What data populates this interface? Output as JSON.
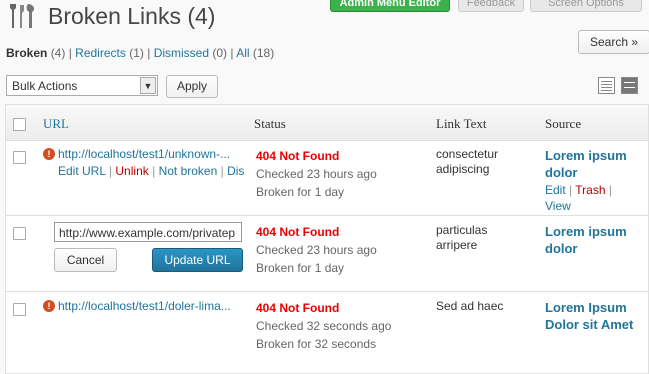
{
  "header": {
    "title": "Broken Links (4)",
    "top_buttons": [
      "Admin Menu Editor",
      "Feedback",
      "Screen Options"
    ]
  },
  "filters": [
    {
      "label": "Broken",
      "count": "(4)",
      "current": true
    },
    {
      "label": "Redirects",
      "count": "(1)"
    },
    {
      "label": "Dismissed",
      "count": "(0)"
    },
    {
      "label": "All",
      "count": "(18)"
    }
  ],
  "search_button": "Search »",
  "bulk_actions": {
    "selected": "Bulk Actions",
    "apply_label": "Apply"
  },
  "table": {
    "columns": [
      "URL",
      "Status",
      "Link Text",
      "Source"
    ],
    "rows": [
      {
        "url": "http://localhost/test1/unknown-...",
        "actions": [
          "Edit URL",
          "Unlink",
          "Not broken",
          "Dis"
        ],
        "status": "404 Not Found",
        "checked": "Checked 23 hours ago",
        "broken": "Broken for 1 day",
        "link_text": [
          "consectetur",
          "adipiscing"
        ],
        "source": [
          "Lorem ipsum",
          "dolor"
        ],
        "source_actions": [
          "Edit",
          "Trash",
          "View"
        ]
      },
      {
        "edit_value": "http://www.example.com/privatep",
        "cancel_label": "Cancel",
        "update_label": "Update URL",
        "status": "404 Not Found",
        "checked": "Checked 23 hours ago",
        "broken": "Broken for 1 day",
        "link_text": [
          "particulas",
          "arripere"
        ],
        "source": [
          "Lorem ipsum",
          "dolor"
        ]
      },
      {
        "url": "http://localhost/test1/doler-lima...",
        "status": "404 Not Found",
        "checked": "Checked 32 seconds ago",
        "broken": "Broken for 32 seconds",
        "link_text": [
          "Sed ad haec"
        ],
        "source": [
          "Lorem Ipsum",
          "Dolor sit Amet"
        ]
      }
    ]
  },
  "colors": {
    "accent": "#21759b",
    "error": "#ee0000",
    "green": "#3bb34a"
  }
}
